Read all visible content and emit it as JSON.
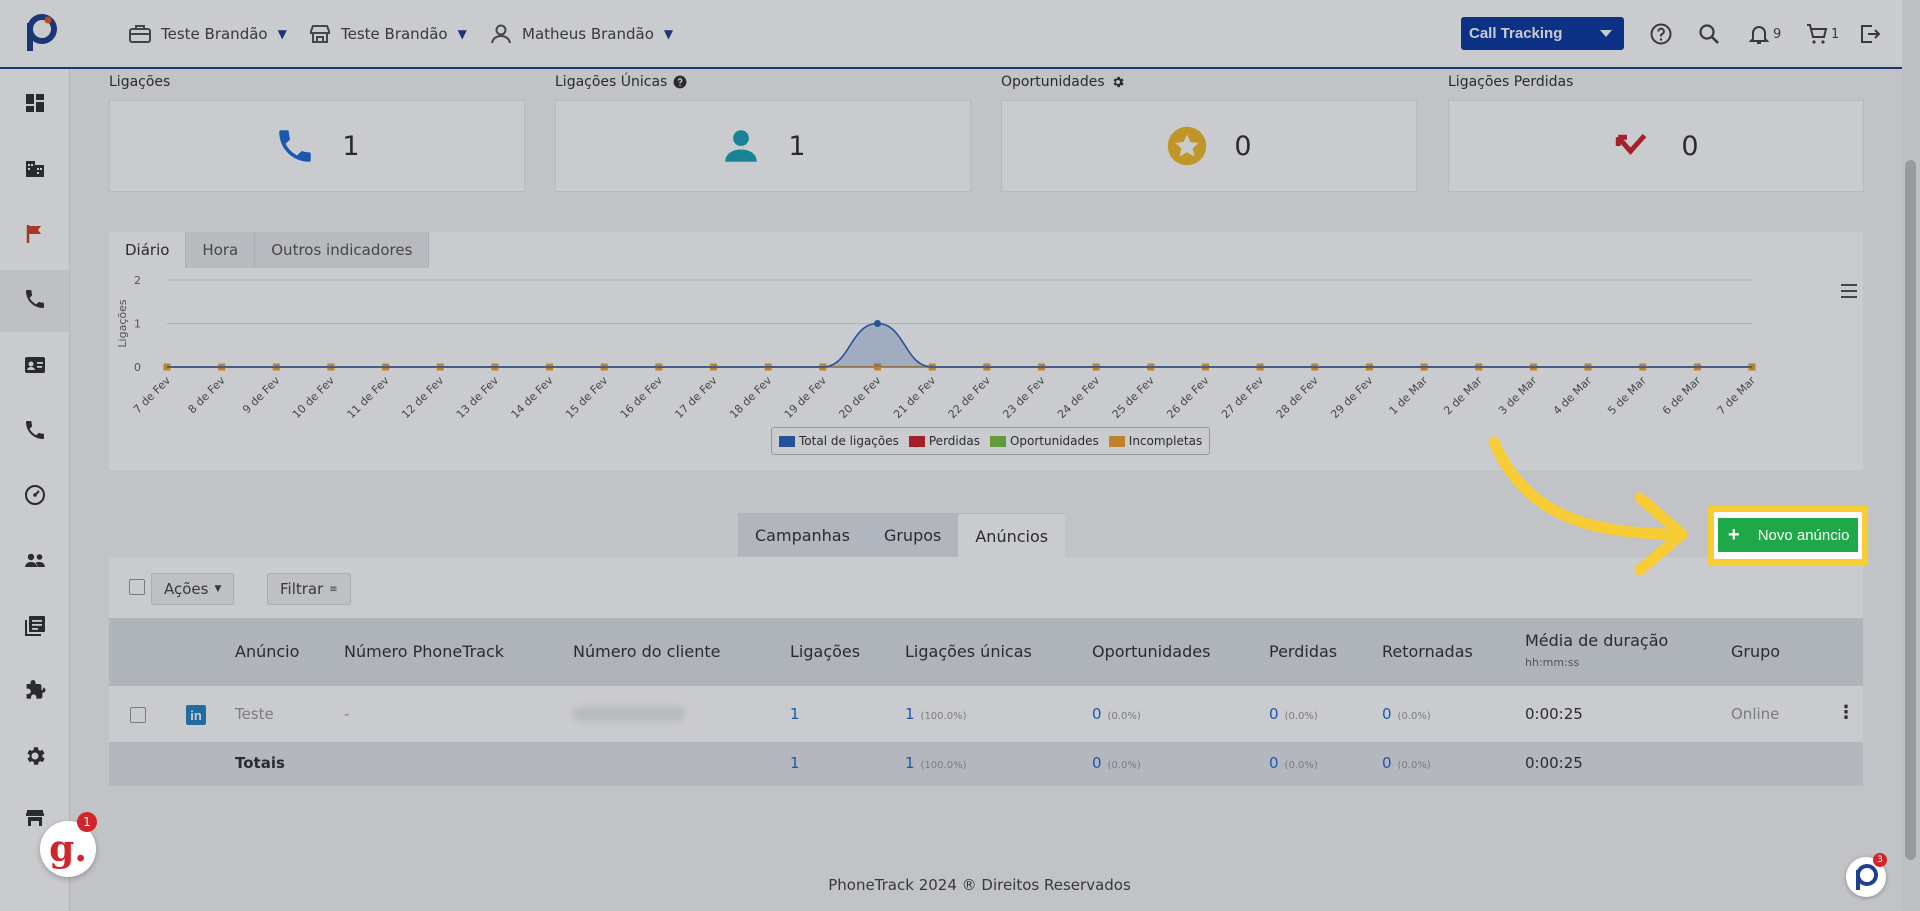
{
  "header": {
    "company_selector": "Teste Brandão",
    "store_selector": "Teste Brandão",
    "user_selector": "Matheus Brandão",
    "product_select": "Call Tracking",
    "notifications_count": "9",
    "cart_count": "1"
  },
  "stats": [
    {
      "label": "Ligações",
      "value": "1"
    },
    {
      "label": "Ligações Únicas",
      "value": "1"
    },
    {
      "label": "Oportunidades",
      "value": "0"
    },
    {
      "label": "Ligações Perdidas",
      "value": "0"
    }
  ],
  "chart_tabs": [
    "Diário",
    "Hora",
    "Outros indicadores"
  ],
  "chart_data": {
    "type": "area",
    "ylabel": "Ligações",
    "ylim": [
      0,
      2
    ],
    "yticks": [
      "0",
      "1",
      "2"
    ],
    "categories": [
      "7 de Fev",
      "8 de Fev",
      "9 de Fev",
      "10 de Fev",
      "11 de Fev",
      "12 de Fev",
      "13 de Fev",
      "14 de Fev",
      "15 de Fev",
      "16 de Fev",
      "17 de Fev",
      "18 de Fev",
      "19 de Fev",
      "20 de Fev",
      "21 de Fev",
      "22 de Fev",
      "23 de Fev",
      "24 de Fev",
      "25 de Fev",
      "26 de Fev",
      "27 de Fev",
      "28 de Fev",
      "29 de Fev",
      "1 de Mar",
      "2 de Mar",
      "3 de Mar",
      "4 de Mar",
      "5 de Mar",
      "6 de Mar",
      "7 de Mar"
    ],
    "series": [
      {
        "name": "Total de ligações",
        "color": "#2e63b8",
        "values": [
          0,
          0,
          0,
          0,
          0,
          0,
          0,
          0,
          0,
          0,
          0,
          0,
          0,
          1,
          0,
          0,
          0,
          0,
          0,
          0,
          0,
          0,
          0,
          0,
          0,
          0,
          0,
          0,
          0,
          0
        ]
      },
      {
        "name": "Perdidas",
        "color": "#d0252b",
        "values": [
          0,
          0,
          0,
          0,
          0,
          0,
          0,
          0,
          0,
          0,
          0,
          0,
          0,
          0,
          0,
          0,
          0,
          0,
          0,
          0,
          0,
          0,
          0,
          0,
          0,
          0,
          0,
          0,
          0,
          0
        ]
      },
      {
        "name": "Oportunidades",
        "color": "#7cc242",
        "values": [
          0,
          0,
          0,
          0,
          0,
          0,
          0,
          0,
          0,
          0,
          0,
          0,
          0,
          0,
          0,
          0,
          0,
          0,
          0,
          0,
          0,
          0,
          0,
          0,
          0,
          0,
          0,
          0,
          0,
          0
        ]
      },
      {
        "name": "Incompletas",
        "color": "#f0a030",
        "values": [
          0,
          0,
          0,
          0,
          0,
          0,
          0,
          0,
          0,
          0,
          0,
          0,
          0,
          0,
          0,
          0,
          0,
          0,
          0,
          0,
          0,
          0,
          0,
          0,
          0,
          0,
          0,
          0,
          0,
          0
        ]
      }
    ],
    "legend": "bottom-center",
    "grid": true
  },
  "table_tabs": [
    "Campanhas",
    "Grupos",
    "Anúncios"
  ],
  "toolbar": {
    "actions": "Ações",
    "filter": "Filtrar"
  },
  "new_ad_button": "Novo anúncio",
  "columns": [
    "Anúncio",
    "Número PhoneTrack",
    "Número do cliente",
    "Ligações",
    "Ligações únicas",
    "Oportunidades",
    "Perdidas",
    "Retornadas",
    "Média de duração",
    "Grupo"
  ],
  "duration_hint": "hh:mm:ss",
  "rows": [
    {
      "anuncio": "Teste",
      "numero_phonetrack": "-",
      "ligacoes": "1",
      "ligacoes_unicas": "1",
      "ligacoes_unicas_pct": "(100.0%)",
      "oportunidades": "0",
      "oportunidades_pct": "(0.0%)",
      "perdidas": "0",
      "perdidas_pct": "(0.0%)",
      "retornadas": "0",
      "retornadas_pct": "(0.0%)",
      "media_duracao": "0:00:25",
      "grupo": "Online"
    }
  ],
  "totals": {
    "label": "Totais",
    "ligacoes": "1",
    "ligacoes_unicas": "1",
    "ligacoes_unicas_pct": "(100.0%)",
    "oportunidades": "0",
    "oportunidades_pct": "(0.0%)",
    "perdidas": "0",
    "perdidas_pct": "(0.0%)",
    "retornadas": "0",
    "retornadas_pct": "(0.0%)",
    "media_duracao": "0:00:25"
  },
  "footer": "PhoneTrack 2024 ® Direitos Reservados",
  "chat_badge": {
    "letter": "g.",
    "count": "1"
  },
  "help_badge": {
    "count": "3"
  },
  "colors": {
    "brand": "#0d3aa0",
    "accent_green": "#1fa847",
    "highlight_yellow": "#f7cc35"
  }
}
